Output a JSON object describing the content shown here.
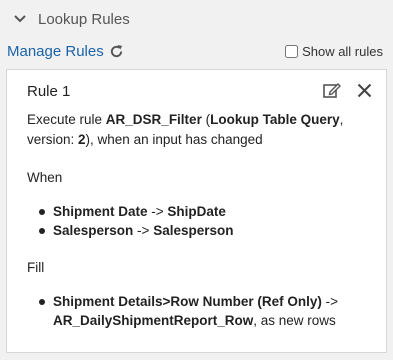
{
  "panel": {
    "title": "Lookup Rules"
  },
  "toolbar": {
    "manage_label": "Manage Rules",
    "show_all_label": "Show all rules"
  },
  "rule": {
    "title": "Rule 1",
    "desc_prefix": "Execute rule ",
    "rule_name": "AR_DSR_Filter",
    "desc_paren_open": " (",
    "rule_type": "Lookup Table Query",
    "desc_version_pre": ", version: ",
    "version": "2",
    "desc_suffix": "), when an input has changed",
    "when_label": "When",
    "when_items": [
      {
        "left": "Shipment Date",
        "arrow": " -> ",
        "right": "ShipDate"
      },
      {
        "left": "Salesperson",
        "arrow": " -> ",
        "right": "Salesperson"
      }
    ],
    "fill_label": "Fill",
    "fill_item": {
      "left": "Shipment Details>Row Number (Ref Only)",
      "arrow": " ->",
      "right": "AR_DailyShipmentReport_Row",
      "suffix": ", as new rows"
    }
  }
}
